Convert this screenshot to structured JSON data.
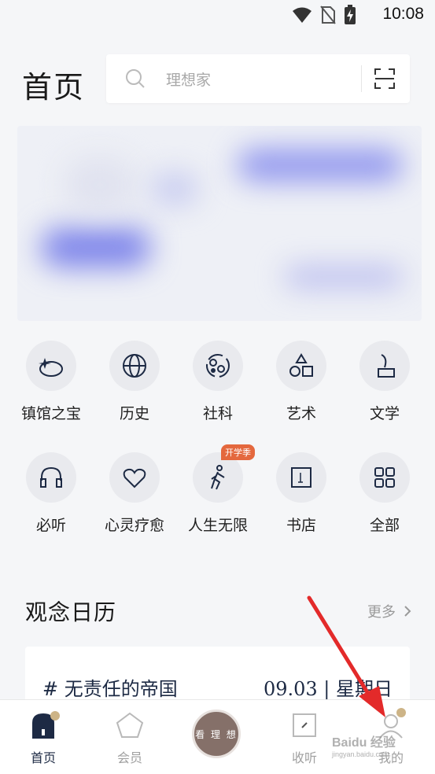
{
  "status_bar": {
    "time": "10:08",
    "icons": [
      "wifi-icon",
      "no-sim-icon",
      "battery-charging-icon"
    ]
  },
  "header": {
    "title": "首页"
  },
  "search": {
    "placeholder": "理想家",
    "icon": "search-icon",
    "scan_icon": "scan-icon"
  },
  "categories": [
    {
      "label": "镇馆之宝",
      "icon": "treasure-icon"
    },
    {
      "label": "历史",
      "icon": "globe-icon"
    },
    {
      "label": "社科",
      "icon": "molecule-icon"
    },
    {
      "label": "艺术",
      "icon": "shapes-icon"
    },
    {
      "label": "文学",
      "icon": "quill-icon"
    },
    {
      "label": "必听",
      "icon": "headphones-icon"
    },
    {
      "label": "心灵疗愈",
      "icon": "heart-icon"
    },
    {
      "label": "人生无限",
      "icon": "walking-person-icon",
      "badge": "开学季"
    },
    {
      "label": "书店",
      "icon": "book-icon"
    },
    {
      "label": "全部",
      "icon": "grid-icon"
    }
  ],
  "calendar": {
    "title": "观念日历",
    "more": "更多",
    "topic": "# 无责任的帝国",
    "date": "09.03 | 星期日"
  },
  "tabbar": {
    "items": [
      {
        "label": "首页",
        "icon": "home-icon",
        "active": true
      },
      {
        "label": "会员",
        "icon": "pentagon-icon",
        "active": false
      },
      {
        "label": "看 理 想",
        "icon": "center-logo",
        "active": false
      },
      {
        "label": "收听",
        "icon": "listen-icon",
        "active": false
      },
      {
        "label": "我的",
        "icon": "profile-icon",
        "active": false
      }
    ]
  },
  "watermark": {
    "text": "Baidu 经验",
    "sub": "jingyan.baidu.com"
  },
  "colors": {
    "accent": "#1d2a44",
    "badge": "#e4683e",
    "dot": "#cdb487",
    "arrow": "#e32a2a"
  }
}
